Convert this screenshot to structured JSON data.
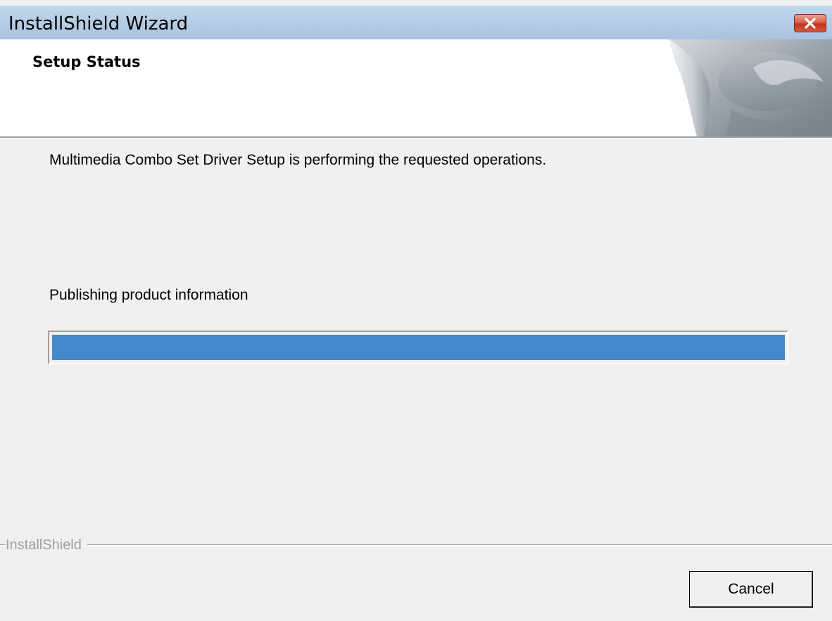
{
  "window": {
    "title": "InstallShield Wizard"
  },
  "header": {
    "title": "Setup Status"
  },
  "main": {
    "description": "Multimedia Combo Set Driver Setup is performing the requested operations.",
    "status": "Publishing product information",
    "progress_fraction": 1.0
  },
  "footer": {
    "brand": "InstallShield",
    "cancel_label": "Cancel"
  },
  "colors": {
    "progress_fill": "#4489ca",
    "titlebar": "#b6cde6",
    "close_button": "#d9604b",
    "dialog_bg": "#f0f0f0"
  },
  "icons": {
    "close": "close-icon",
    "header_art": "page-curl-graphic"
  }
}
